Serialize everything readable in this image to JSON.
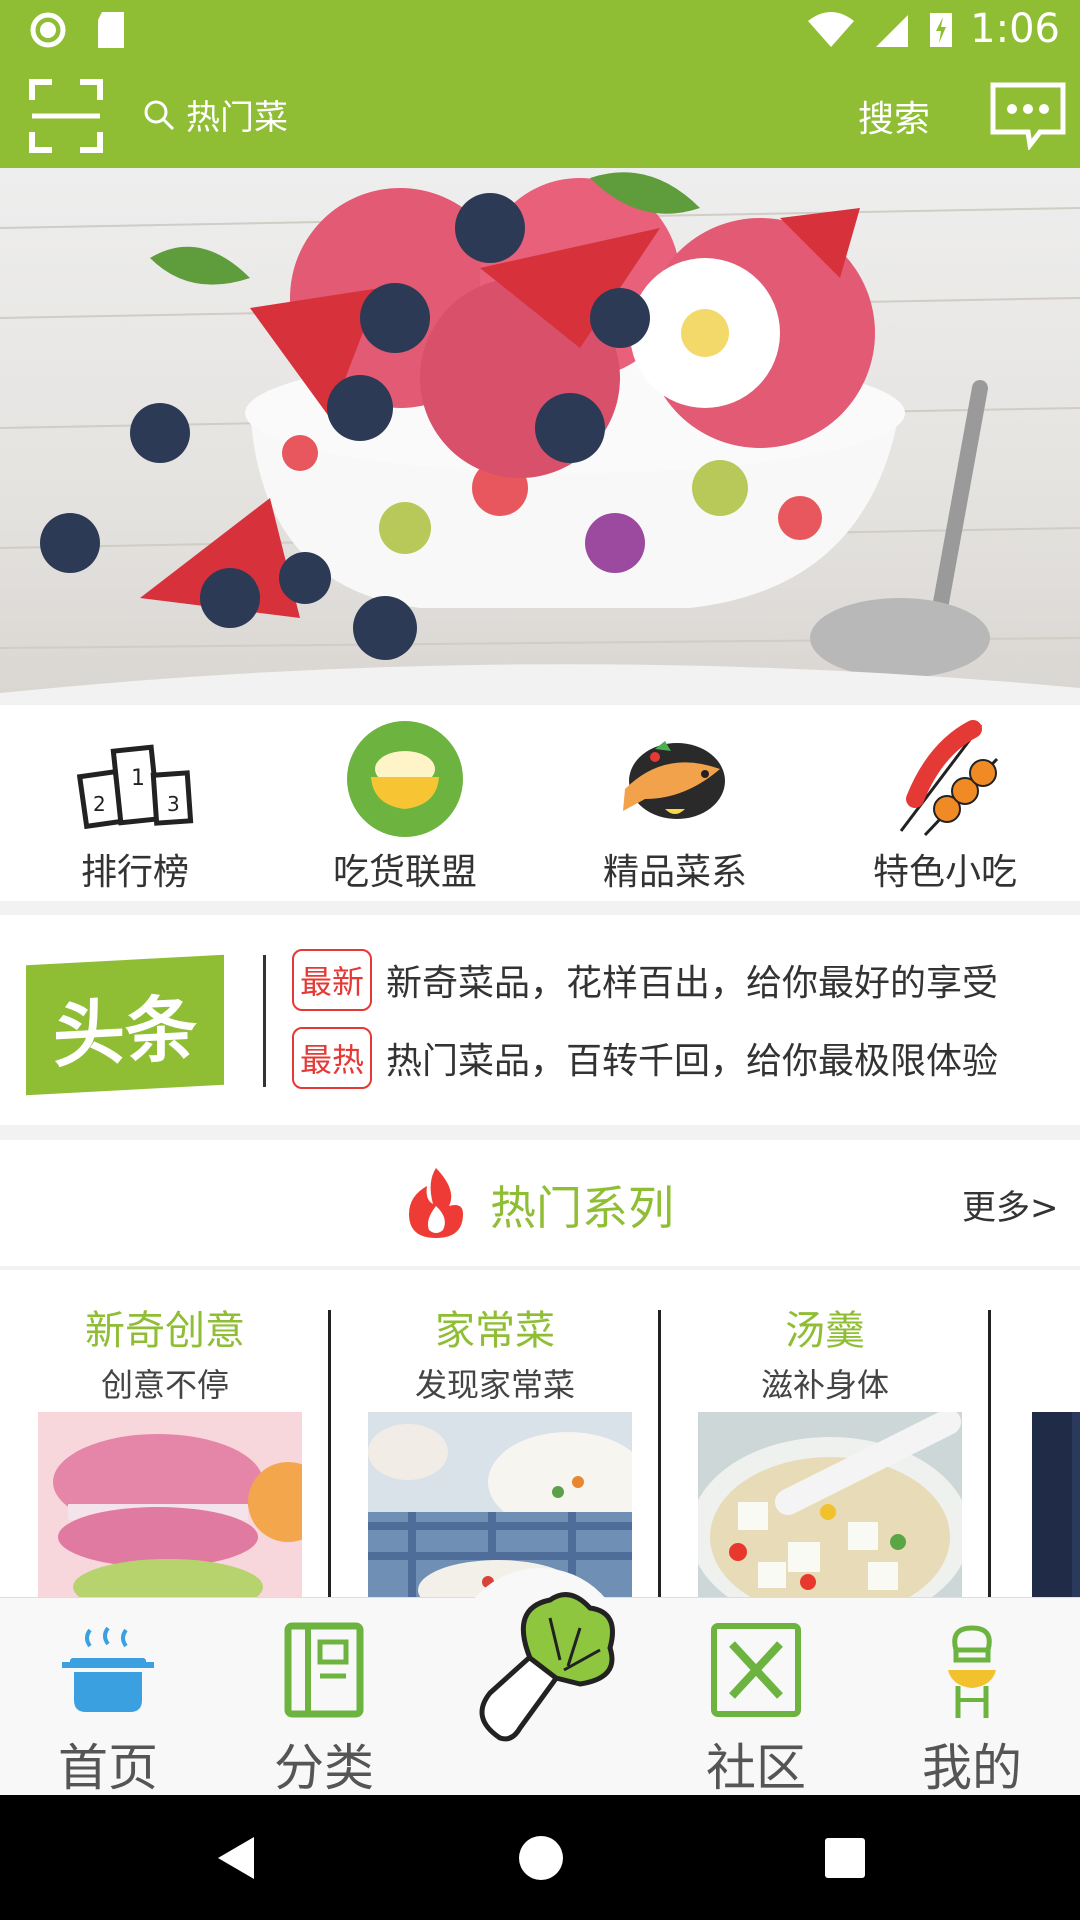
{
  "status_bar": {
    "time": "1:06"
  },
  "header": {
    "search_placeholder": "热门菜",
    "search_button": "搜索"
  },
  "quick_nav": [
    {
      "label": "排行榜",
      "icon": "podium-icon"
    },
    {
      "label": "吃货联盟",
      "icon": "rice-bowl-icon"
    },
    {
      "label": "精品菜系",
      "icon": "fish-dish-icon"
    },
    {
      "label": "特色小吃",
      "icon": "skewer-icon"
    }
  ],
  "headlines": {
    "logo": "头条",
    "items": [
      {
        "tag": "最新",
        "text": "新奇菜品，花样百出，给你最好的享受"
      },
      {
        "tag": "最热",
        "text": "热门菜品，百转千回，给你最极限体验"
      }
    ]
  },
  "hot_series": {
    "title": "热门系列",
    "more": "更多>",
    "cards": [
      {
        "title": "新奇创意",
        "subtitle": "创意不停"
      },
      {
        "title": "家常菜",
        "subtitle": "发现家常菜"
      },
      {
        "title": "汤羹",
        "subtitle": "滋补身体"
      }
    ]
  },
  "bottom_nav": [
    {
      "label": "首页",
      "icon": "pot-icon"
    },
    {
      "label": "分类",
      "icon": "notebook-icon"
    },
    {
      "label": "",
      "icon": "vegetable-icon"
    },
    {
      "label": "社区",
      "icon": "fork-knife-icon"
    },
    {
      "label": "我的",
      "icon": "chef-icon"
    }
  ],
  "colors": {
    "brand": "#8fbe35",
    "tag_red": "#e53935"
  }
}
